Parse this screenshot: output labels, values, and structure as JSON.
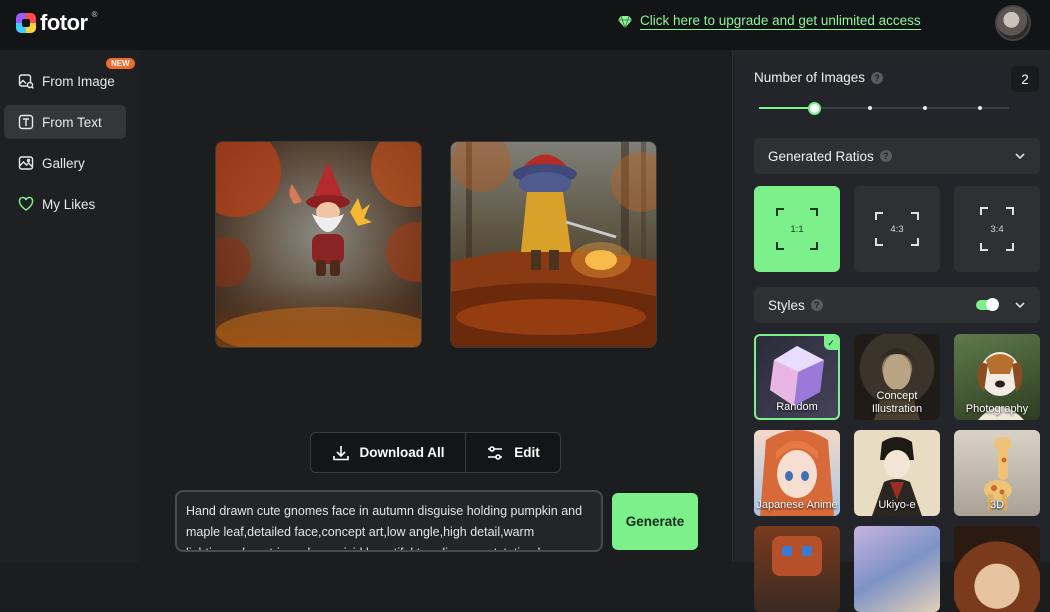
{
  "app": {
    "name": "fotor",
    "reg": "®"
  },
  "header": {
    "upgrade_text": "Click here to upgrade and get unlimited access"
  },
  "sidebar": {
    "badge": "NEW",
    "items": [
      {
        "label": "From Image",
        "icon": "image-search-icon"
      },
      {
        "label": "From Text",
        "icon": "text-box-icon"
      },
      {
        "label": "Gallery",
        "icon": "gallery-icon"
      },
      {
        "label": "My Likes",
        "icon": "heart-icon"
      }
    ],
    "active_index": 1
  },
  "main": {
    "download_label": "Download All",
    "edit_label": "Edit",
    "prompt_text": "Hand drawn cute gnomes face in autumn disguise holding pumpkin and maple leaf,detailed face,concept art,low angle,high detail,warm lighting,volumetric,godrays,vivid,beautiful,trending on artstation,by",
    "generate_label": "Generate"
  },
  "panel": {
    "num_images_label": "Number of Images",
    "num_images_value": "2",
    "num_images_fraction": 0.22,
    "ratios_label": "Generated Ratios",
    "ratios": [
      "1:1",
      "4:3",
      "3:4"
    ],
    "selected_ratio": "1:1",
    "styles_label": "Styles",
    "styles_enabled": true,
    "styles": [
      {
        "name": "Random",
        "selected": true
      },
      {
        "name": "Concept Illustration"
      },
      {
        "name": "Photography"
      },
      {
        "name": "Japanese Anime"
      },
      {
        "name": "Ukiyo-e"
      },
      {
        "name": "3D"
      }
    ]
  },
  "colors": {
    "accent": "#7cf08b",
    "badge": "#f26a2b",
    "background": "#1c1d1f"
  }
}
